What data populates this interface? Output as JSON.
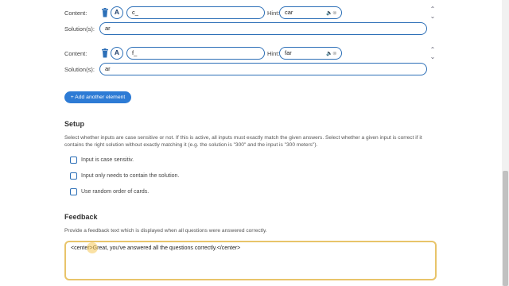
{
  "elements": [
    {
      "content_label": "Content:",
      "content_value": "c_",
      "hint_label": "Hint:",
      "hint_value": "car",
      "solution_label": "Solution(s):",
      "solution_value": "ar"
    },
    {
      "content_label": "Content:",
      "content_value": "f_",
      "hint_label": "Hint:",
      "hint_value": "far",
      "solution_label": "Solution(s):",
      "solution_value": "ar"
    }
  ],
  "icons": {
    "format": "A",
    "audio": "🔈⊗",
    "up": "⌃",
    "down": "⌄"
  },
  "add_button_label": "+ Add another element",
  "setup": {
    "title": "Setup",
    "description": "Select whether inputs are case sensitive or not. If this is active, all inputs must exactly match the given answers. Select whether a given input is correct if it contains the right solution without exactly matching it (e.g. the solution is \"300\" and the input is \"300 meters\").",
    "options": [
      {
        "label": "Input is case sensitiv.",
        "checked": false
      },
      {
        "label": "Input only needs to contain the solution.",
        "checked": false
      },
      {
        "label": "Use random order of cards.",
        "checked": false
      }
    ]
  },
  "feedback": {
    "title": "Feedback",
    "description": "Provide a feedback text which is displayed when all questions were answered correctly.",
    "value": "<center>Great, you've answered all the questions correctly.</center>"
  },
  "colors": {
    "accent": "#2c6fb7",
    "button": "#2d7bd5",
    "focus": "#e8c46a"
  }
}
